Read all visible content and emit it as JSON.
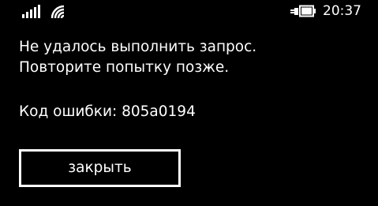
{
  "status_bar": {
    "signal_icon": "cellular-signal-icon",
    "wifi_icon": "wifi-icon",
    "battery_icon": "battery-charging-icon",
    "time": "20:37"
  },
  "dialog": {
    "message_line1": "Не удалось выполнить запрос.",
    "message_line2": "Повторите попытку позже.",
    "error_code": "Код ошибки: 805a0194",
    "close_label": "закрыть"
  },
  "colors": {
    "background": "#000000",
    "foreground": "#ffffff"
  }
}
